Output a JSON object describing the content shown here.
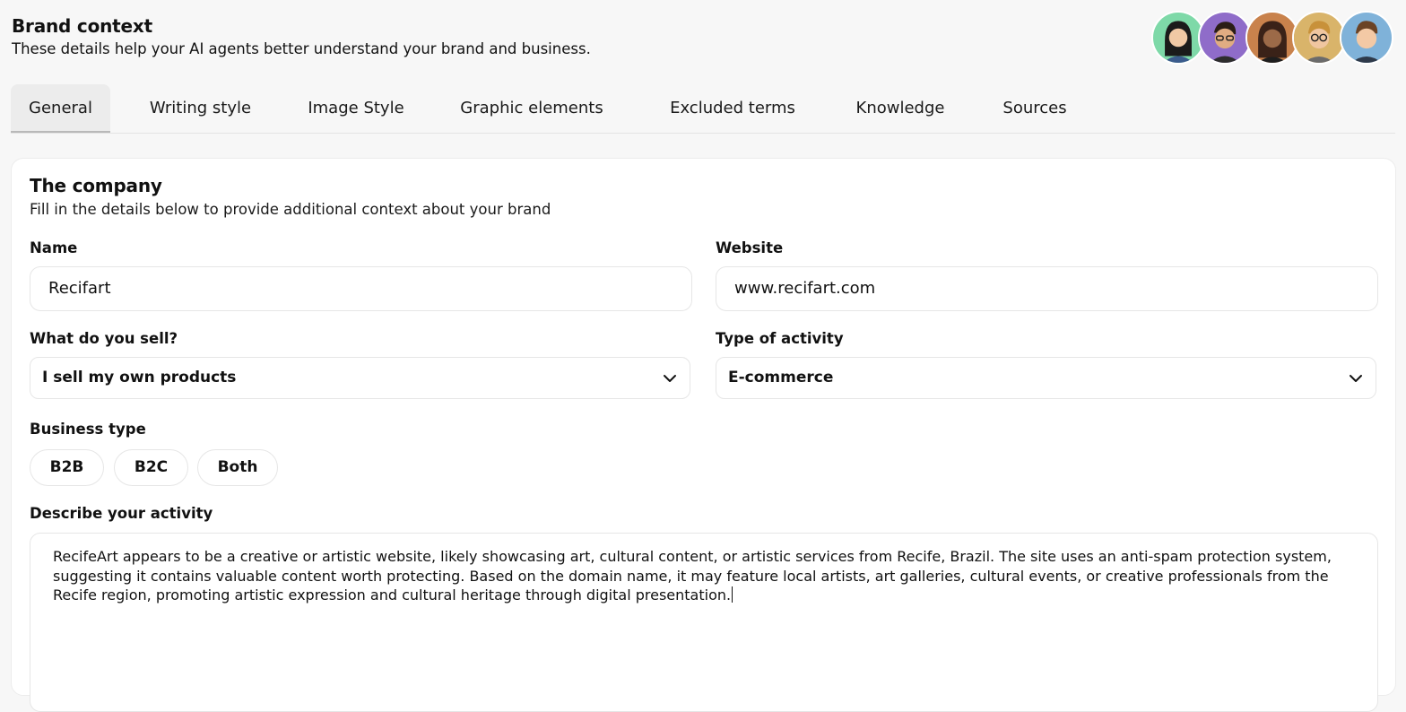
{
  "header": {
    "title": "Brand context",
    "subtitle": "These details help your AI agents better understand your brand and business."
  },
  "avatars": [
    {
      "name": "agent-avatar-1",
      "bg": "#7ed9a8"
    },
    {
      "name": "agent-avatar-2",
      "bg": "#8f6cc9"
    },
    {
      "name": "agent-avatar-3",
      "bg": "#c9824c"
    },
    {
      "name": "agent-avatar-4",
      "bg": "#d9b46a"
    },
    {
      "name": "agent-avatar-5",
      "bg": "#7fb2d9"
    }
  ],
  "tabs": [
    {
      "label": "General",
      "active": true
    },
    {
      "label": "Writing style",
      "active": false
    },
    {
      "label": "Image Style",
      "active": false
    },
    {
      "label": "Graphic elements",
      "active": false
    },
    {
      "label": "Excluded terms",
      "active": false
    },
    {
      "label": "Knowledge",
      "active": false
    },
    {
      "label": "Sources",
      "active": false
    }
  ],
  "company": {
    "title": "The company",
    "description": "Fill in the details below to provide additional context about your brand",
    "name_label": "Name",
    "name_value": "Recifart",
    "website_label": "Website",
    "website_value": "www.recifart.com",
    "sell_label": "What do you sell?",
    "sell_value": "I sell my own products",
    "activity_type_label": "Type of activity",
    "activity_type_value": "E-commerce",
    "business_type_label": "Business type",
    "business_types": [
      "B2B",
      "B2C",
      "Both"
    ],
    "describe_label": "Describe your activity",
    "describe_value": "RecifeArt appears to be a creative or artistic website, likely showcasing art, cultural content, or artistic services from Recife, Brazil. The site uses an anti-spam protection system, suggesting it contains valuable content worth protecting. Based on the domain name, it may feature local artists, art galleries, cultural events, or creative professionals from the Recife region, promoting artistic expression and cultural heritage through digital presentation."
  }
}
